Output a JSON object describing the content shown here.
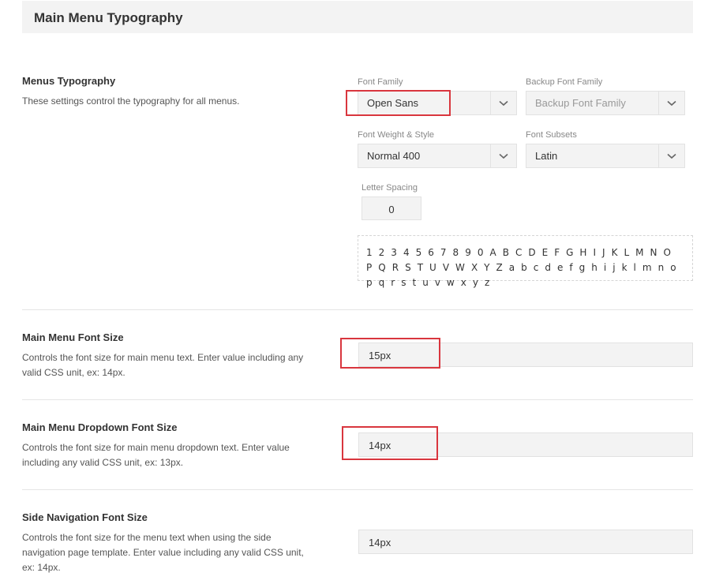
{
  "section": {
    "title": "Main Menu Typography"
  },
  "menus_typography": {
    "title": "Menus Typography",
    "description": "These settings control the typography for all menus.",
    "font_family": {
      "label": "Font Family",
      "value": "Open Sans"
    },
    "backup_font_family": {
      "label": "Backup Font Family",
      "placeholder": "Backup Font Family"
    },
    "font_weight_style": {
      "label": "Font Weight & Style",
      "value": "Normal 400"
    },
    "font_subsets": {
      "label": "Font Subsets",
      "value": "Latin"
    },
    "letter_spacing": {
      "label": "Letter Spacing",
      "value": "0"
    },
    "preview_text": "1 2 3 4 5 6 7 8 9 0 A B C D E F G H I J K L M N O P Q R S T U V W X Y Z a b c d e f g h i j k l m n o p q r s t u v w x y z"
  },
  "main_menu_font_size": {
    "title": "Main Menu Font Size",
    "description": "Controls the font size for main menu text. Enter value including any valid CSS unit, ex: 14px.",
    "value": "15px"
  },
  "dropdown_font_size": {
    "title": "Main Menu Dropdown Font Size",
    "description": "Controls the font size for main menu dropdown text. Enter value including any valid CSS unit, ex: 13px.",
    "value": "14px"
  },
  "side_nav_font_size": {
    "title": "Side Navigation Font Size",
    "description": "Controls the font size for the menu text when using the side navigation page template. Enter value including any valid CSS unit, ex: 14px.",
    "value": "14px"
  },
  "colors": {
    "highlight": "#d9363e",
    "field_bg": "#f3f3f3"
  },
  "icons": {
    "select_arrow": "chevron-down-icon"
  }
}
